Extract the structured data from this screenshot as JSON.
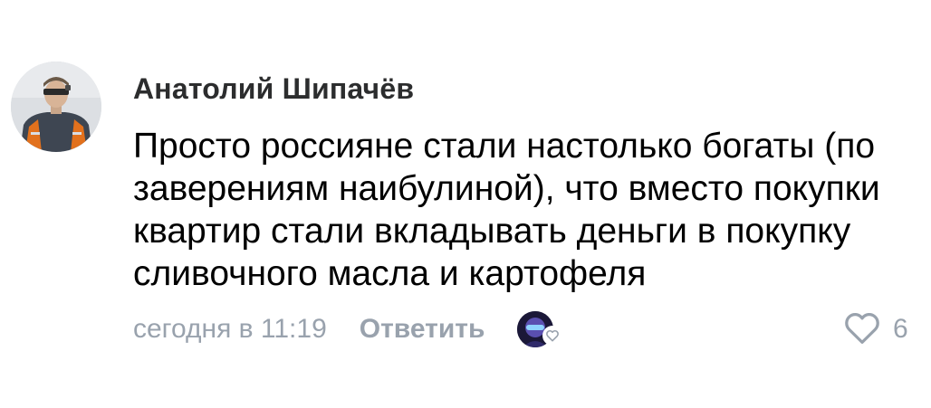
{
  "comment": {
    "author": "Анатолий Шипачёв",
    "text": "Просто россияне стали настолько богаты (по заверениям наибулиной), что вместо покупки квартир стали вкладывать деньги в покупку сливочного масла и картофеля",
    "timestamp": "сегодня в 11:19",
    "reply_label": "Ответить",
    "like_count": "6"
  },
  "icons": {
    "author_avatar": "avatar-photo",
    "author_like_badge": "heart-outline-icon",
    "like": "heart-outline-icon"
  },
  "colors": {
    "author": "#2c2d2e",
    "text": "#000000",
    "secondary": "#99a2ad",
    "background": "#ffffff"
  }
}
